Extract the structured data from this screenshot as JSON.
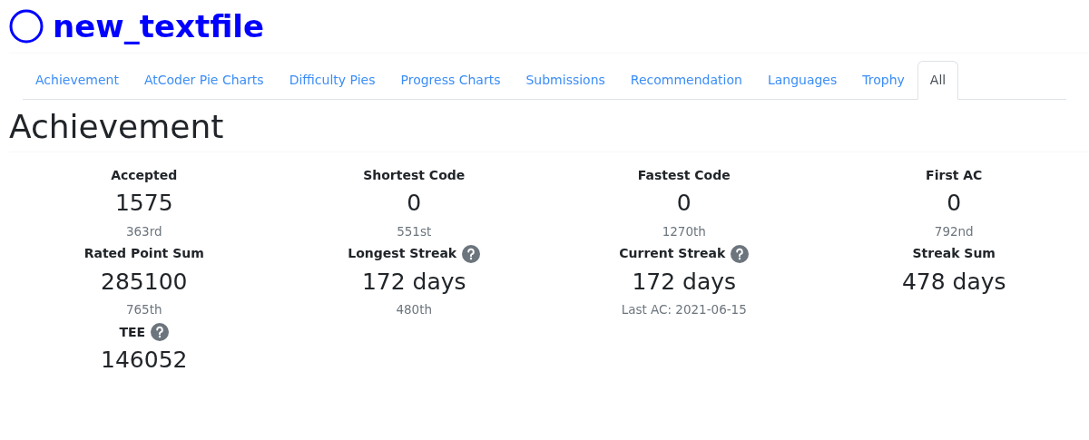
{
  "user": {
    "name": "new_textfile"
  },
  "tabs": [
    {
      "label": "Achievement",
      "selected": false
    },
    {
      "label": "AtCoder Pie Charts",
      "selected": false
    },
    {
      "label": "Difficulty Pies",
      "selected": false
    },
    {
      "label": "Progress Charts",
      "selected": false
    },
    {
      "label": "Submissions",
      "selected": false
    },
    {
      "label": "Recommendation",
      "selected": false
    },
    {
      "label": "Languages",
      "selected": false
    },
    {
      "label": "Trophy",
      "selected": false
    },
    {
      "label": "All",
      "selected": true
    }
  ],
  "section_title": "Achievement",
  "stat_columns": [
    [
      {
        "label": "Accepted",
        "value": "1575",
        "sub": "363rd"
      },
      {
        "label": "Rated Point Sum",
        "value": "285100",
        "sub": "765th"
      },
      {
        "label": "TEE",
        "value": "146052",
        "help": true
      }
    ],
    [
      {
        "label": "Shortest Code",
        "value": "0",
        "sub": "551st"
      },
      {
        "label": "Longest Streak",
        "value": "172 days",
        "sub": "480th",
        "help": true
      }
    ],
    [
      {
        "label": "Fastest Code",
        "value": "0",
        "sub": "1270th"
      },
      {
        "label": "Current Streak",
        "value": "172 days",
        "sub": "Last AC: 2021-06-15",
        "help": true
      }
    ],
    [
      {
        "label": "First AC",
        "value": "0",
        "sub": "792nd"
      },
      {
        "label": "Streak Sum",
        "value": "478 days"
      }
    ]
  ]
}
